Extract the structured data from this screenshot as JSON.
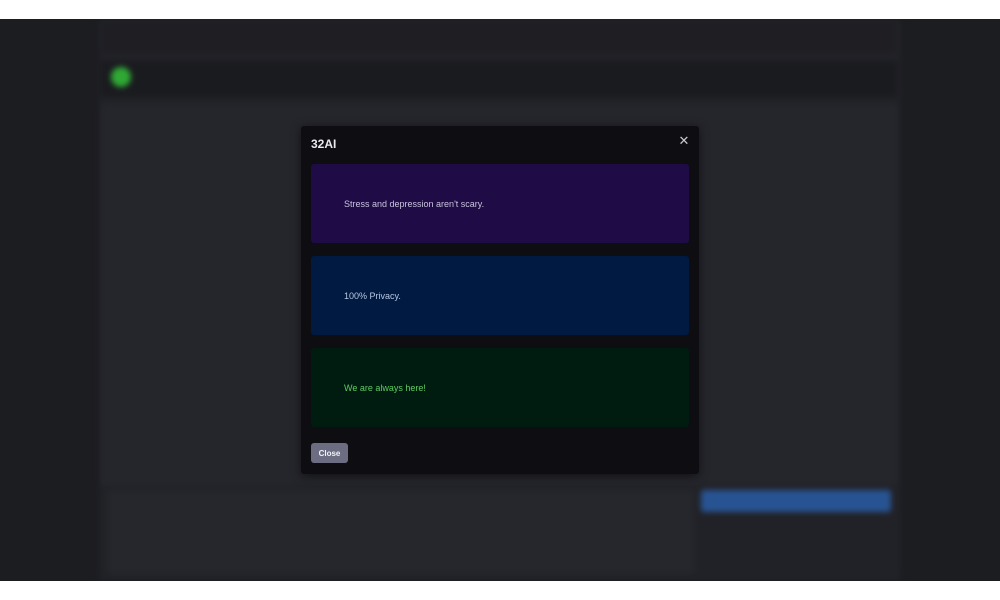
{
  "modal": {
    "title": "32AI",
    "close_icon": "close-icon",
    "close_glyph": "✕",
    "cards": [
      {
        "text": "Stress and depression aren't scary.",
        "color": "#1f0b45"
      },
      {
        "text": "100% Privacy.",
        "color": "#001a42"
      },
      {
        "text": "We are always here!",
        "color": "#001b0f"
      }
    ],
    "close_button_label": "Close"
  }
}
